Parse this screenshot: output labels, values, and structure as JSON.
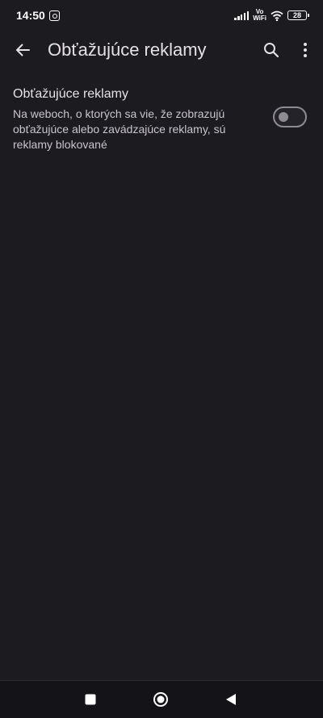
{
  "status_bar": {
    "time": "14:50",
    "network_label": "Vo\nWiFi",
    "battery": "28",
    "icons": [
      "instagram-icon",
      "signal-icon",
      "wifi-icon",
      "battery-icon"
    ]
  },
  "app_bar": {
    "title": "Obťažujúce reklamy",
    "icons": [
      "back-arrow-icon",
      "search-icon",
      "more-vert-icon"
    ]
  },
  "setting": {
    "title": "Obťažujúce reklamy",
    "summary": "Na weboch, o ktorých sa vie, že zobrazujú obťažujúce alebo zavádzajúce reklamy, sú reklamy blokované",
    "enabled": false
  },
  "nav_bar": {
    "icons": [
      "recents-square-icon",
      "home-circle-icon",
      "back-triangle-icon"
    ]
  },
  "colors": {
    "background": "#1c1b20",
    "text_primary": "#e6e1e5",
    "text_secondary": "#c9c5cc",
    "toggle_outline": "#8f8b92"
  }
}
